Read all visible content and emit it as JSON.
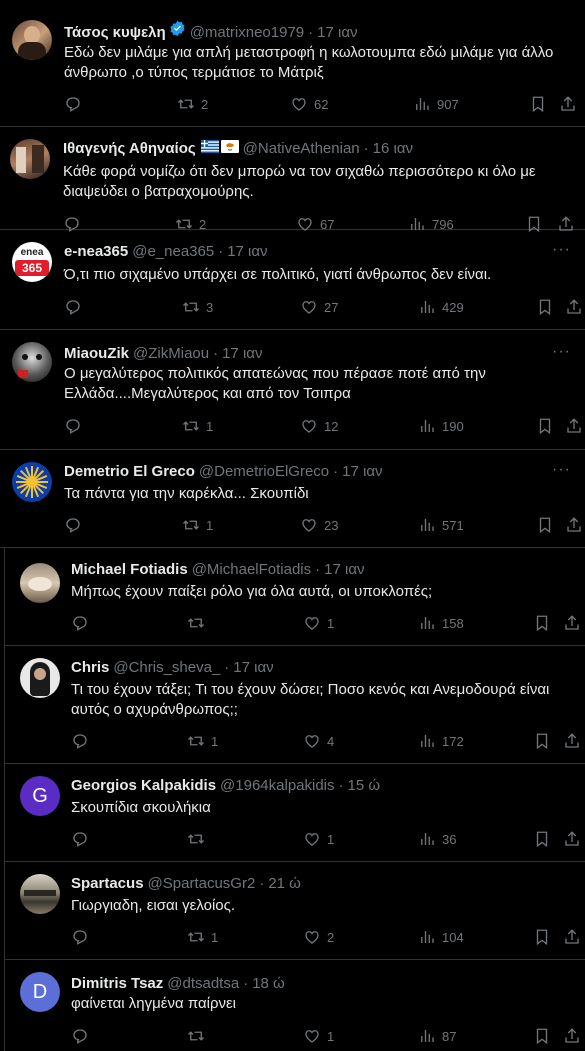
{
  "tweets": [
    {
      "name": "Τάσος κυψελη",
      "handle": "@matrixneo1979",
      "time": "17 ιαν",
      "verified": true,
      "lines": [
        "Εδώ δεν μιλάμε για απλή μεταστροφή η κωλοτουμπα εδώ μιλάμε για άλλο",
        "άνθρωπο ,ο τύπος τερμάτισε το Μάτριξ"
      ],
      "retweets": "2",
      "likes": "62",
      "views": "907"
    },
    {
      "name": "Ιθαγενής Αθηναίος",
      "handle": "@NativeAthenian",
      "time": "16 ιαν",
      "flags": true,
      "lines": [
        "Κάθε φορά νομίζω ότι δεν μπορώ να τον σιχαθώ περισσότερο κι όλο με",
        "διαψεύδει ο βατραχομούρης."
      ],
      "retweets": "2",
      "likes": "67",
      "views": "796"
    },
    {
      "name": "e-nea365",
      "handle": "@e_nea365",
      "time": "17 ιαν",
      "lines": [
        "Ό,τι πιο σιχαμένο υπάρχει σε πολιτικό, γιατί άνθρωπος δεν είναι."
      ],
      "retweets": "3",
      "likes": "27",
      "views": "429",
      "avatar_text": [
        "enea",
        "365"
      ]
    },
    {
      "name": "MiaouZik",
      "handle": "@ZikMiaou",
      "time": "17 ιαν",
      "lines": [
        "Ο μεγαλύτερος πολιτικός απατεώνας που πέρασε ποτέ από την",
        "Ελλάδα....Μεγαλύτερος και από τον Τσιπρα"
      ],
      "retweets": "1",
      "likes": "12",
      "views": "190"
    },
    {
      "name": "Demetrio El Greco",
      "handle": "@DemetrioElGreco",
      "time": "17 ιαν",
      "lines": [
        "Τα πάντα για την καρέκλα... Σκουπίδι"
      ],
      "retweets": "1",
      "likes": "23",
      "views": "571"
    },
    {
      "name": "Michael Fotiadis",
      "handle": "@MichaelFotiadis",
      "time": "17 ιαν",
      "lines": [
        "Μήπως έχουν παίξει ρόλο για όλα αυτά, οι υποκλοπές;"
      ],
      "retweets": "",
      "likes": "1",
      "views": "158"
    },
    {
      "name": "Chris",
      "handle": "@Chris_sheva_",
      "time": "17 ιαν",
      "lines": [
        "Τι του έχουν τάξει; Τι του έχουν δώσει; Ποσο κενός και Ανεμοδουρά είναι",
        "αυτός ο αχυράνθρωπος;;"
      ],
      "retweets": "1",
      "likes": "4",
      "views": "172"
    },
    {
      "name": "Georgios Kalpakidis",
      "handle": "@1964kalpakidis",
      "time": "15 ώ",
      "lines": [
        "Σκουπίδια σκουλήκια"
      ],
      "retweets": "",
      "likes": "1",
      "views": "36",
      "avatar_letter": "G"
    },
    {
      "name": "Spartacus",
      "handle": "@SpartacusGr2",
      "time": "21 ώ",
      "lines": [
        "Γιωργιαδη, εισαι γελοίος."
      ],
      "retweets": "1",
      "likes": "2",
      "views": "104"
    },
    {
      "name": "Dimitris Tsaz",
      "handle": "@dtsadtsa",
      "time": "18 ώ",
      "lines": [
        "φαίνεται ληγμένα παίρνει"
      ],
      "retweets": "",
      "likes": "1",
      "views": "87",
      "avatar_letter": "D"
    }
  ],
  "icons": {
    "reply": "reply-icon",
    "retweet": "retweet-icon",
    "like": "like-icon",
    "views": "views-icon",
    "bookmark": "bookmark-icon",
    "share": "share-icon",
    "more": "more-icon"
  },
  "colors": {
    "background": "#000000",
    "text": "#e7e9ea",
    "muted": "#71767b",
    "border": "#2f3336",
    "verified": "#1d9bf0"
  },
  "dots": "···"
}
